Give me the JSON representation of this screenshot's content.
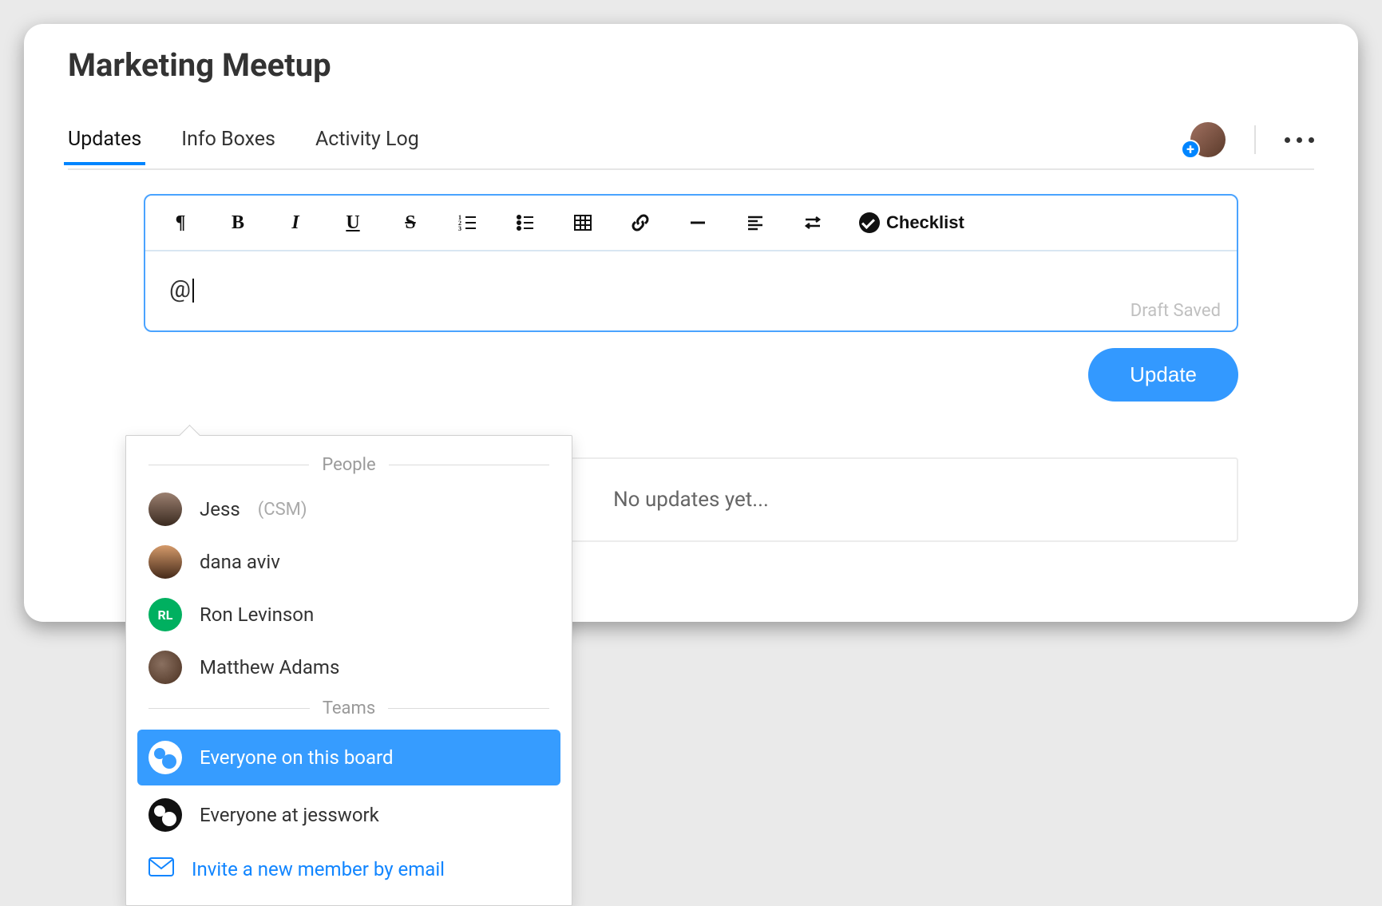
{
  "title": "Marketing Meetup",
  "tabs": {
    "updates": "Updates",
    "infoboxes": "Info Boxes",
    "activity": "Activity Log"
  },
  "toolbar": {
    "checklist": "Checklist"
  },
  "editor": {
    "value": "@",
    "draft_saved": "Draft Saved"
  },
  "actions": {
    "update": "Update"
  },
  "empty": "No updates yet...",
  "mention": {
    "section_people": "People",
    "section_teams": "Teams",
    "people": {
      "jess": {
        "name": "Jess",
        "sub": "(CSM)"
      },
      "dana": {
        "name": "dana aviv"
      },
      "ron": {
        "name": "Ron Levinson",
        "initials": "RL"
      },
      "matt": {
        "name": "Matthew Adams"
      }
    },
    "teams": {
      "everyone_board": "Everyone on this board",
      "everyone_company": "Everyone at jesswork"
    },
    "invite": "Invite a new member by email"
  }
}
